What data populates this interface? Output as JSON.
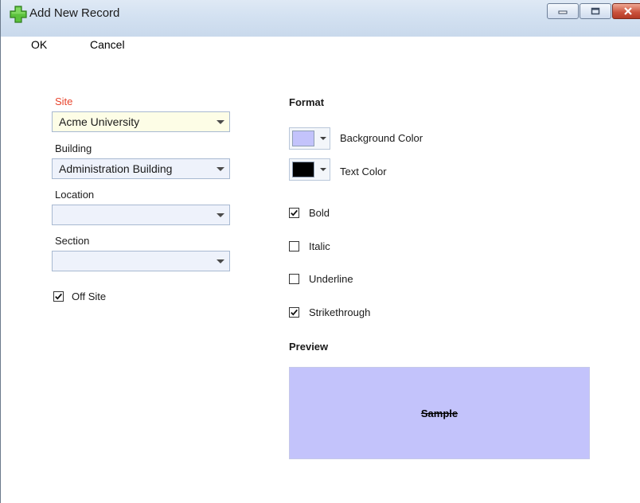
{
  "window": {
    "title": "Add New Record",
    "app_icon": "green-plus-icon"
  },
  "window_controls": {
    "minimize_icon": "minimize-icon",
    "maximize_icon": "maximize-icon",
    "close_icon": "close-icon"
  },
  "menu": {
    "ok_label": "OK",
    "cancel_label": "Cancel"
  },
  "form": {
    "site": {
      "label": "Site",
      "value": "Acme University",
      "required": true
    },
    "building": {
      "label": "Building",
      "value": "Administration Building"
    },
    "location": {
      "label": "Location",
      "value": ""
    },
    "section": {
      "label": "Section",
      "value": ""
    },
    "off_site": {
      "label": "Off Site",
      "checked": true
    }
  },
  "format": {
    "heading": "Format",
    "background_color": {
      "label": "Background Color",
      "color": "#c3c3fb"
    },
    "text_color": {
      "label": "Text Color",
      "color": "#000000"
    },
    "bold": {
      "label": "Bold",
      "checked": true
    },
    "italic": {
      "label": "Italic",
      "checked": false
    },
    "underline": {
      "label": "Underline",
      "checked": false
    },
    "strikethrough": {
      "label": "Strikethrough",
      "checked": true
    }
  },
  "preview": {
    "heading": "Preview",
    "sample_text": "Sample",
    "background": "#c3c3fb"
  },
  "colors": {
    "required_label": "#e8442c",
    "titlebar": "#d3e1f1",
    "combo_background": "#eef2fb"
  }
}
